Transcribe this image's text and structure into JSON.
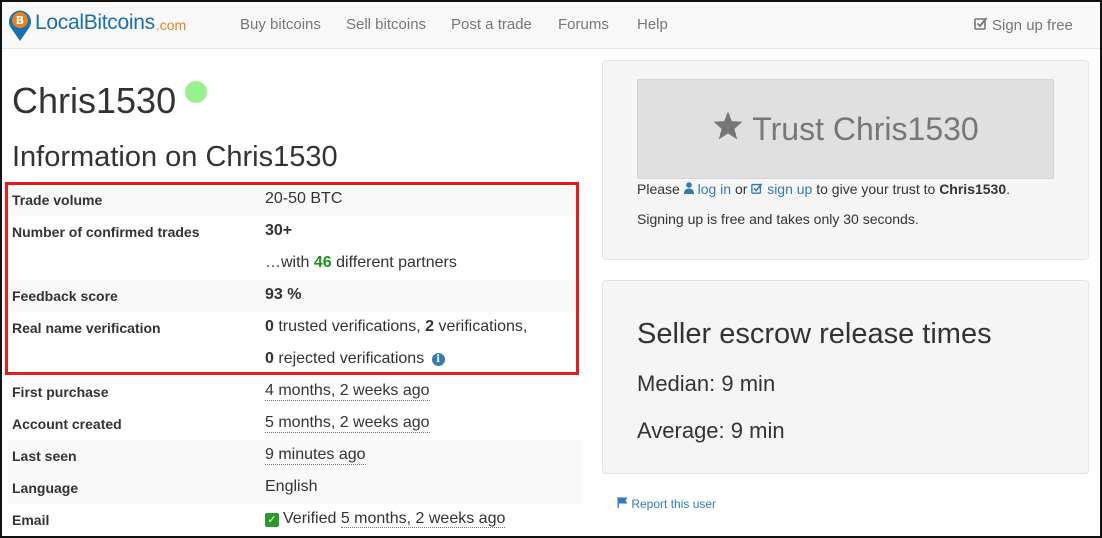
{
  "nav": {
    "brand_name": "LocalBitcoins",
    "brand_tld": ".com",
    "items": [
      "Buy bitcoins",
      "Sell bitcoins",
      "Post a trade",
      "Forums",
      "Help"
    ],
    "signup": "Sign up free"
  },
  "profile": {
    "username": "Chris1530",
    "status_color": "#98f08f",
    "info_title": "Information on Chris1530"
  },
  "info": {
    "trade_volume_label": "Trade volume",
    "trade_volume_value": "20-50 BTC",
    "confirmed_label": "Number of confirmed trades",
    "confirmed_value": "30+",
    "partners_prefix": "…with",
    "partners_count": "46",
    "partners_suffix": "different partners",
    "feedback_label": "Feedback score",
    "feedback_value": "93 %",
    "realname_label": "Real name verification",
    "trusted_count": "0",
    "trusted_text": "trusted verifications,",
    "verif_count": "2",
    "verif_text": "verifications,",
    "rejected_count": "0",
    "rejected_text": "rejected verifications",
    "first_purchase_label": "First purchase",
    "first_purchase_value": "4 months, 2 weeks ago",
    "account_created_label": "Account created",
    "account_created_value": "5 months, 2 weeks ago",
    "last_seen_label": "Last seen",
    "last_seen_value": "9 minutes ago",
    "language_label": "Language",
    "language_value": "English",
    "email_label": "Email",
    "email_verified": "Verified",
    "email_value": "5 months, 2 weeks ago"
  },
  "trust": {
    "button_label": "Trust Chris1530",
    "please": "Please",
    "login": "log in",
    "or": "or",
    "signup": "sign up",
    "to_give": "to give your trust to",
    "target": "Chris1530",
    "period": ".",
    "signing_note": "Signing up is free and takes only 30 seconds."
  },
  "escrow": {
    "title": "Seller escrow release times",
    "median": "Median: 9 min",
    "average": "Average: 9 min"
  },
  "report": "Report this user",
  "colors": {
    "brand_blue": "#1a6fb0",
    "brand_orange": "#e8821e",
    "link": "#337ab7",
    "highlight_red": "#e31c1c",
    "positive_green": "#1f8f1f"
  }
}
